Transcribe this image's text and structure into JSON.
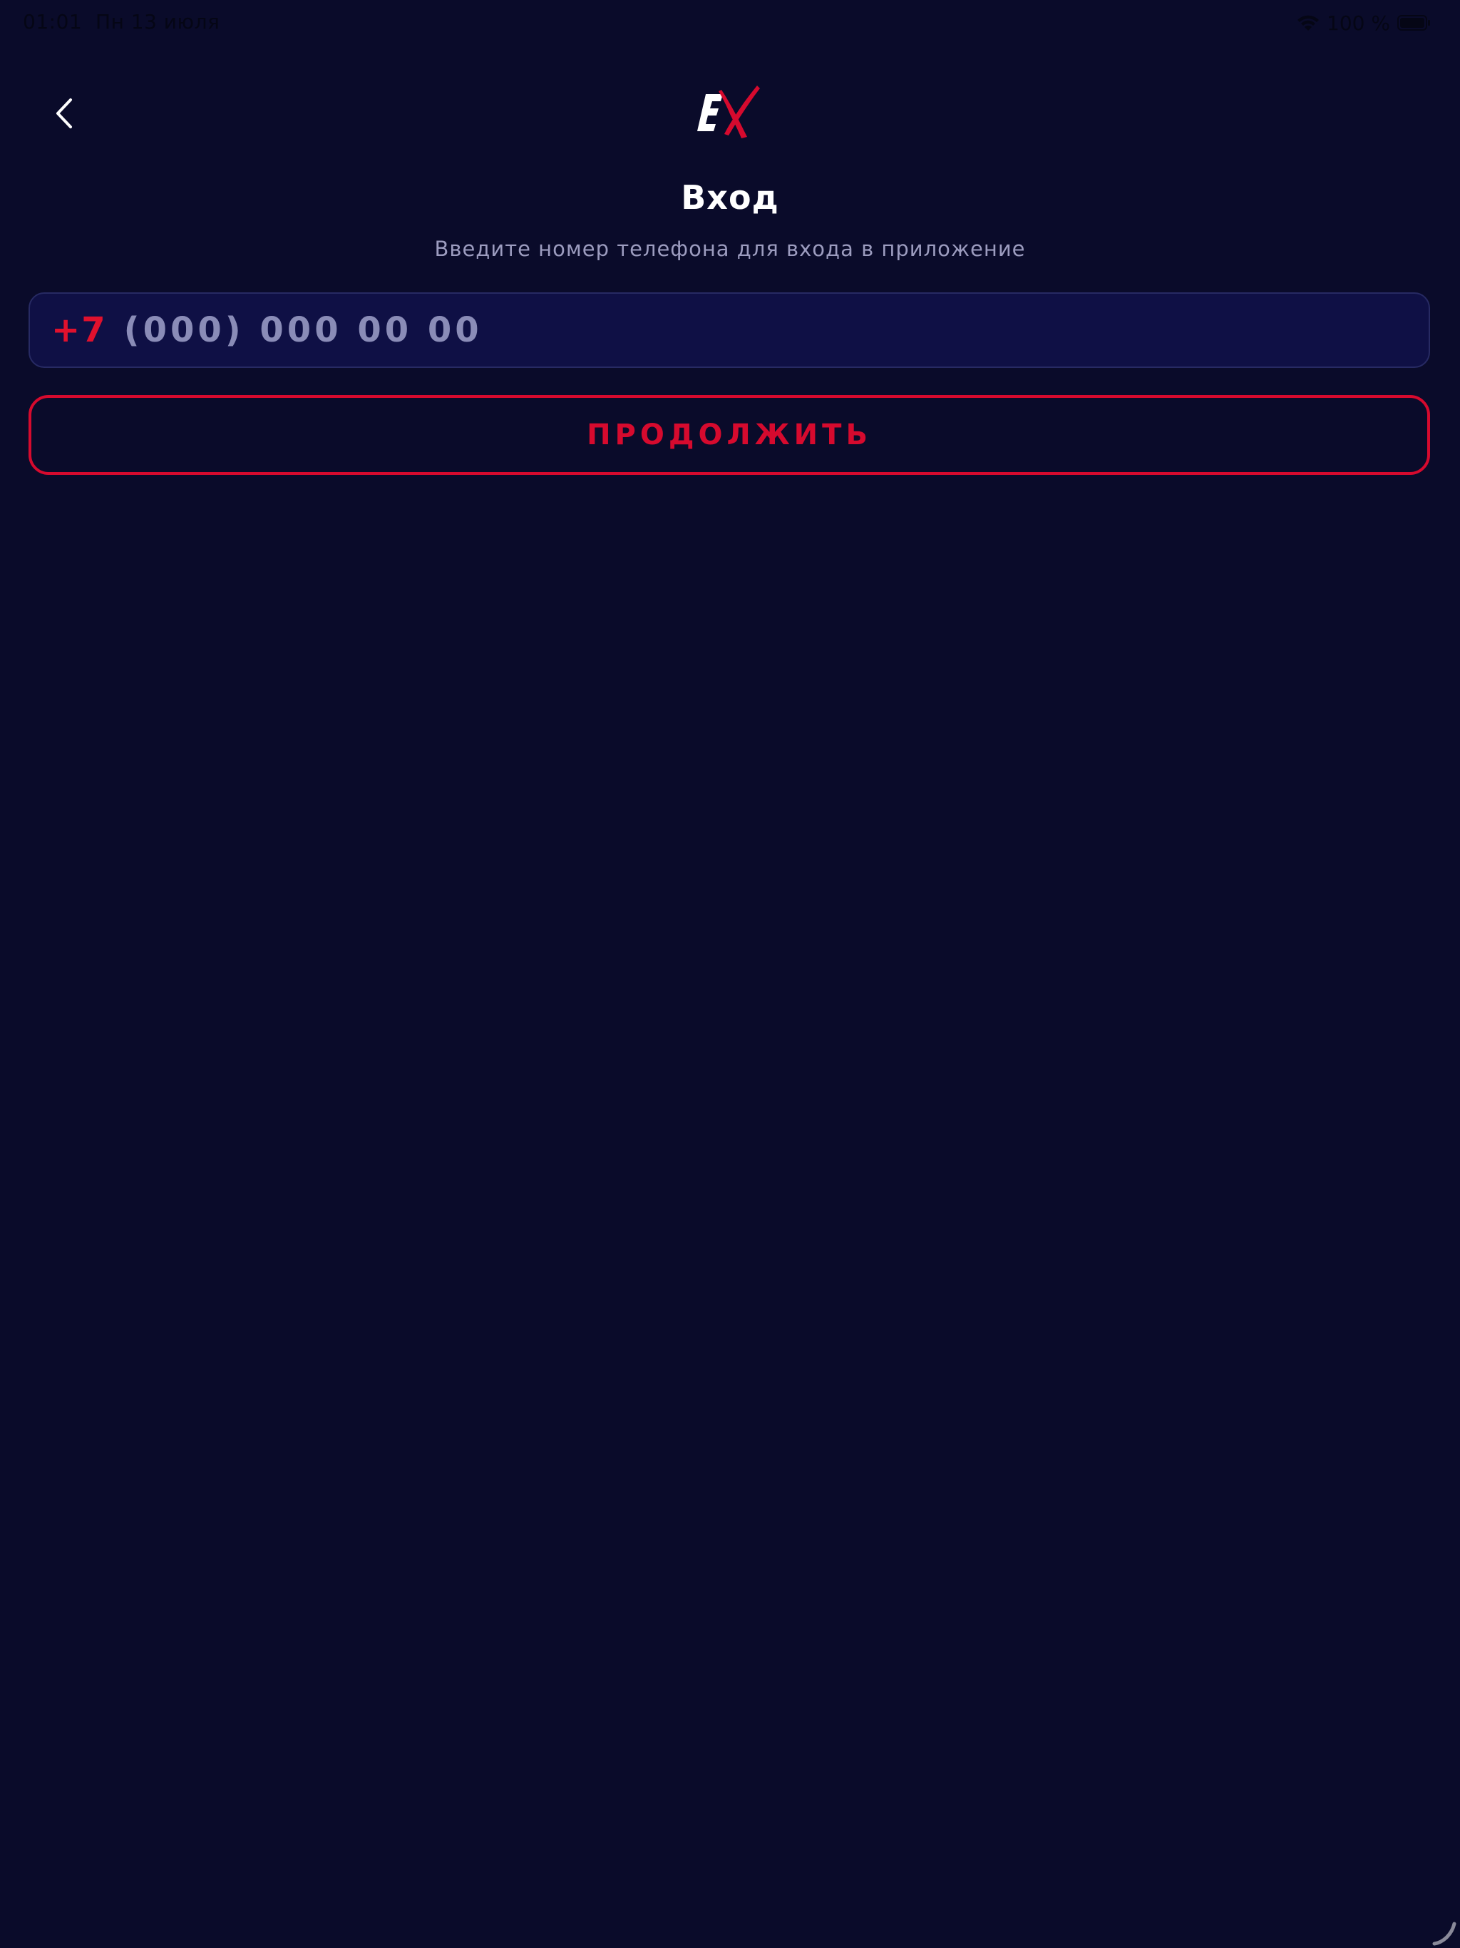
{
  "status_bar": {
    "time": "01:01",
    "date": "Пн 13 июля",
    "battery": "100 %",
    "icons": [
      "wifi-icon",
      "battery-icon"
    ]
  },
  "nav": {
    "back_icon": "chevron-left-icon",
    "logo_text": "EX"
  },
  "login": {
    "title": "Вход",
    "subtitle": "Введите номер телефона для входа в приложение",
    "phone_prefix": "+7",
    "phone_placeholder": "(000) 000 00 00",
    "continue_label": "ПРОДОЛЖИТЬ"
  },
  "colors": {
    "background": "#0a0b2a",
    "accent": "#d60a2e",
    "input_bg": "#0f1045",
    "muted_text": "#9c9cbf"
  }
}
